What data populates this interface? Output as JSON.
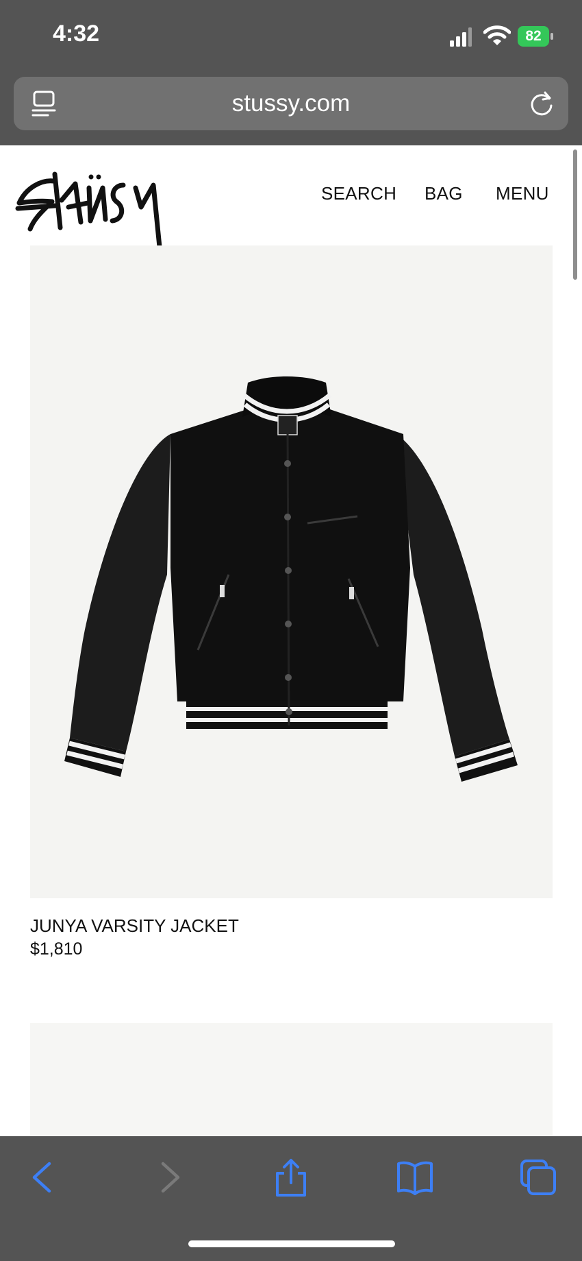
{
  "status_bar": {
    "time": "4:32",
    "battery_level": "82",
    "battery_color": "#34c759",
    "icons": [
      "cellular-signal-icon",
      "wifi-icon",
      "battery-charging-icon"
    ]
  },
  "browser": {
    "url": "stussy.com",
    "toolbar_icons": [
      "reader-view-icon",
      "reload-icon",
      "back-icon",
      "forward-icon",
      "share-icon",
      "bookmarks-icon",
      "tabs-icon"
    ],
    "accent_color": "#3d7ff5"
  },
  "site": {
    "logo_alt": "Stüssy",
    "nav": {
      "search": "SEARCH",
      "bag": "BAG",
      "menu": "MENU"
    }
  },
  "products": [
    {
      "name": "JUNYA VARSITY JACKET",
      "price": "$1,810",
      "image_icon": "varsity-jacket-image"
    }
  ]
}
